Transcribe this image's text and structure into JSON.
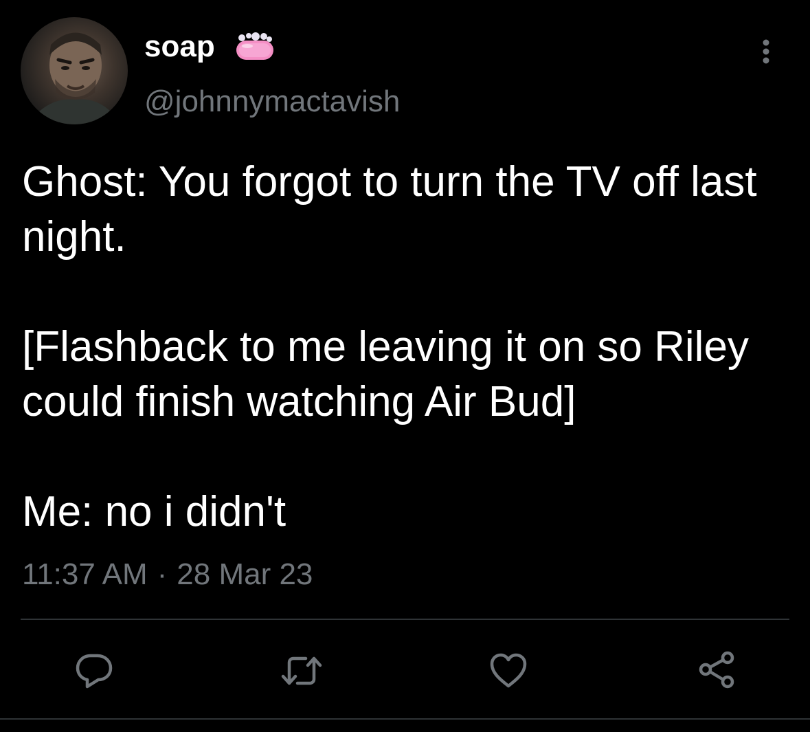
{
  "tweet": {
    "author": {
      "display_name": "soap",
      "handle": "@johnnymactavish",
      "name_emoji": "soap-emoji"
    },
    "text_paragraphs": [
      "Ghost: You forgot to turn the TV off last night.",
      "[Flashback to me leaving it on so Riley could finish watching Air Bud]",
      "Me: no i didn't"
    ],
    "time": "11:37 AM",
    "separator": "·",
    "date": "28 Mar 23"
  },
  "actions": [
    {
      "name": "reply",
      "icon": "reply-icon"
    },
    {
      "name": "retweet",
      "icon": "retweet-icon"
    },
    {
      "name": "like",
      "icon": "heart-icon"
    },
    {
      "name": "share",
      "icon": "share-icon"
    }
  ],
  "colors": {
    "background": "#000000",
    "text": "#ffffff",
    "secondary_text": "#71767b",
    "divider": "#2f3336"
  }
}
